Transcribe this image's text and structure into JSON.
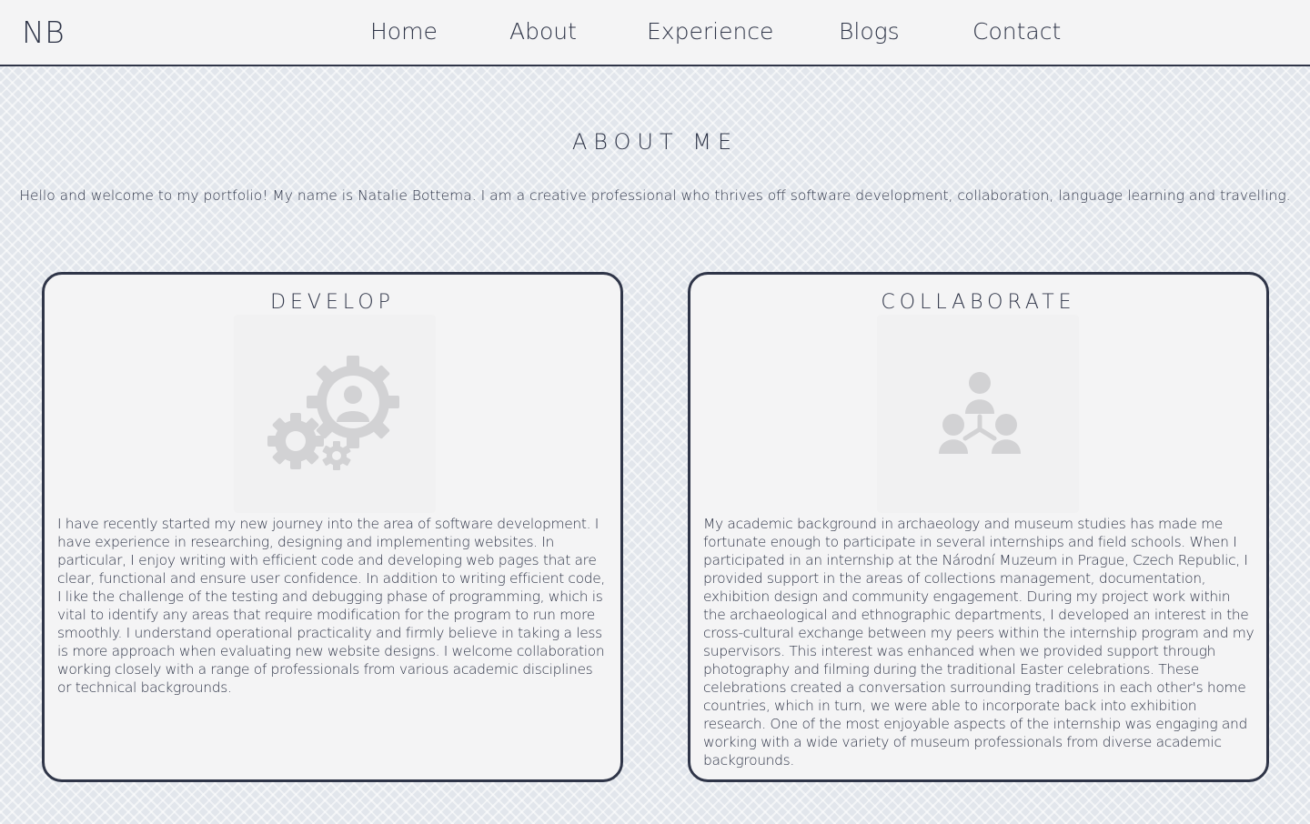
{
  "nav": {
    "logo": "NB",
    "links": [
      "Home",
      "About",
      "Experience",
      "Blogs",
      "Contact"
    ]
  },
  "about": {
    "title": "ABOUT ME",
    "intro": "Hello and welcome to my portfolio! My name is Natalie Bottema. I am a creative professional who thrives off software development, collaboration, language learning and travelling."
  },
  "cards": [
    {
      "title": "DEVELOP",
      "icon": "gears-user-icon",
      "text": "I have recently started my new journey into the area of software development. I have experience in researching, designing and implementing websites. In particular, I enjoy writing with efficient code and developing web pages that are clear, functional and ensure user confidence. In addition to writing efficient code, I like the challenge of the testing and debugging phase of programming, which is vital to identify any areas that require modification for the program to run more smoothly. I understand operational practicality and firmly believe in taking a less is more approach when evaluating new website designs. I welcome collaboration working closely with a range of professionals from various academic disciplines or technical backgrounds."
    },
    {
      "title": "COLLABORATE",
      "icon": "team-hierarchy-icon",
      "text": "My academic background in archaeology and museum studies has made me fortunate enough to participate in several internships and field schools. When I participated in an internship at the Národní Muzeum in Prague, Czech Republic, I provided support in the areas of collections management, documentation, exhibition design and community engagement. During my project work within the archaeological and ethnographic departments, I developed an interest in the cross-cultural exchange between my peers within the internship program and my supervisors. This interest was enhanced when we provided support through photography and filming during the traditional Easter celebrations. These celebrations created a conversation surrounding traditions in each other's home countries, which in turn, we were able to incorporate back into exhibition research. One of the most enjoyable aspects of the internship was engaging and working with a wide variety of museum professionals from diverse academic backgrounds."
    }
  ],
  "colors": {
    "text": "#2f3548",
    "border": "#2f3548",
    "card_bg": "#f4f4f5",
    "icon": "#d2d2d4",
    "page_bg": "#e2e6ec"
  }
}
